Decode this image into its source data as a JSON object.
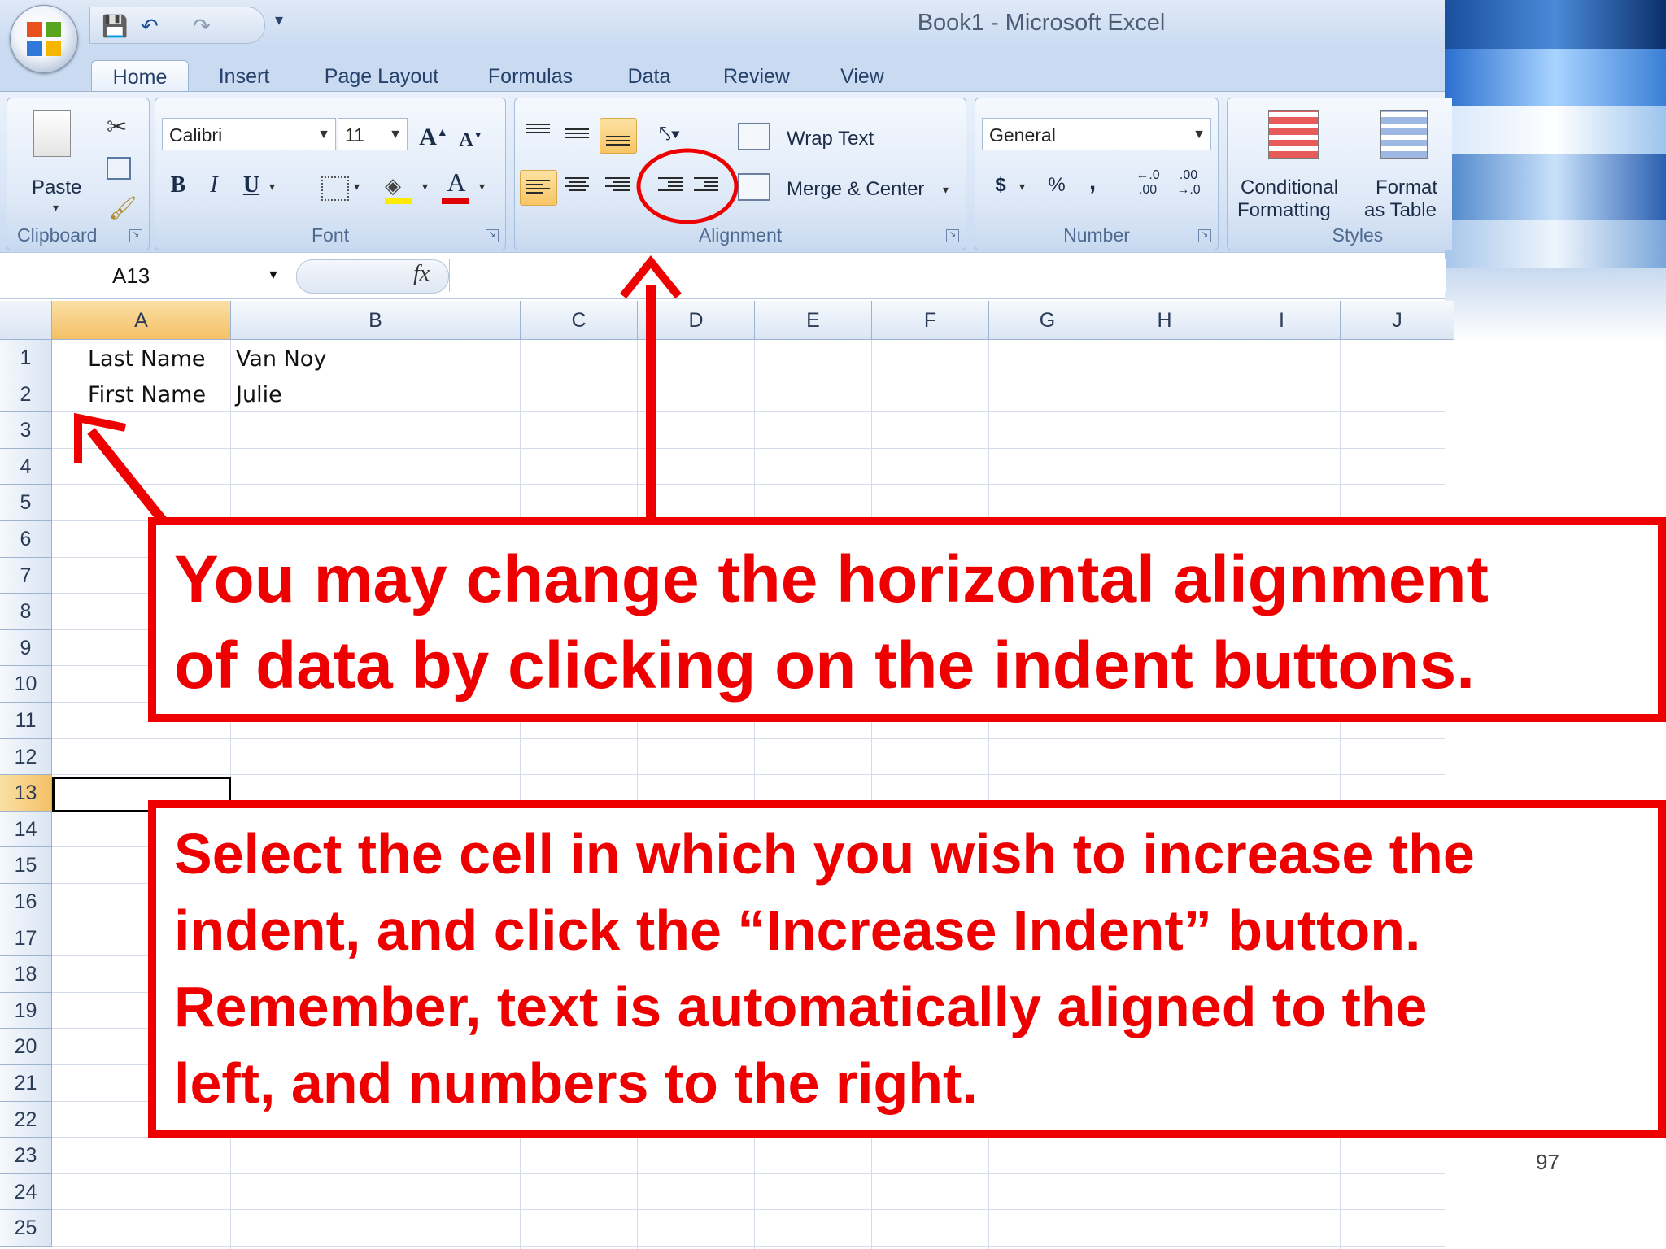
{
  "window": {
    "title": "Book1 - Microsoft Excel"
  },
  "tabs": [
    {
      "label": "Home"
    },
    {
      "label": "Insert"
    },
    {
      "label": "Page Layout"
    },
    {
      "label": "Formulas"
    },
    {
      "label": "Data"
    },
    {
      "label": "Review"
    },
    {
      "label": "View"
    }
  ],
  "ribbon": {
    "clipboard": {
      "label": "Clipboard",
      "paste": "Paste"
    },
    "font": {
      "label": "Font",
      "name": "Calibri",
      "size": "11",
      "bold": "B",
      "italic": "I",
      "underline": "U",
      "font_color": "A"
    },
    "alignment": {
      "label": "Alignment",
      "wrap_text": "Wrap Text",
      "merge_center": "Merge & Center"
    },
    "number": {
      "label": "Number",
      "format": "General",
      "currency": "$",
      "percent": "%",
      "comma": ","
    },
    "styles": {
      "label": "Styles",
      "conditional_line1": "Conditional",
      "conditional_line2": "Formatting",
      "format_line1": "Format",
      "format_line2": "as Table"
    }
  },
  "formula_bar": {
    "name_box": "A13",
    "fx": "fx"
  },
  "columns": [
    "A",
    "B",
    "C",
    "D",
    "E",
    "F",
    "G",
    "H",
    "I",
    "J"
  ],
  "rows": [
    "1",
    "2",
    "3",
    "4",
    "5",
    "6",
    "7",
    "8",
    "9",
    "10",
    "11",
    "12",
    "13",
    "14",
    "15",
    "16",
    "17",
    "18",
    "19",
    "20",
    "21",
    "22",
    "23",
    "24",
    "25"
  ],
  "cells": {
    "a1": "Last Name",
    "b1": "Van Noy",
    "a2": "First Name",
    "b2": "Julie"
  },
  "callouts": {
    "top_line1": "You may change the horizontal alignment",
    "top_line2": "of data by clicking on the indent buttons.",
    "bottom_line1": "Select the cell in which you wish to increase the",
    "bottom_line2": "indent, and click the “Increase Indent” button.",
    "bottom_line3": "Remember, text is automatically aligned to the",
    "bottom_line4": "left, and numbers to the right."
  },
  "slide_number": "97",
  "annotation_color": "#ee0000",
  "selection_color": "#f7c565"
}
